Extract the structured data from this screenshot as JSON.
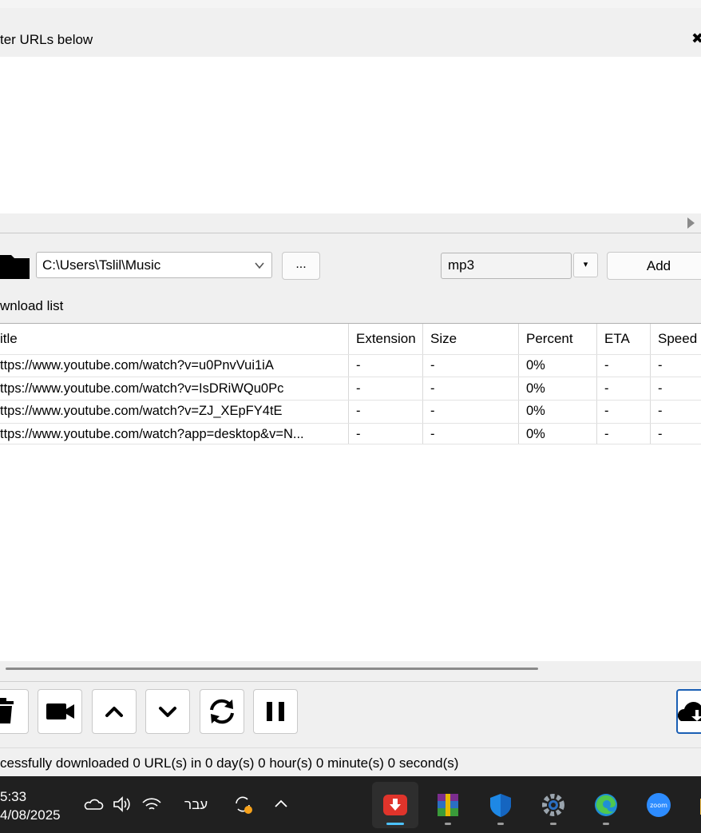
{
  "urls_panel": {
    "label": "ter URLs below",
    "close_glyph": "✖"
  },
  "toolbar": {
    "folder_icon": "folder-icon",
    "save_path": "C:\\Users\\Tslil\\Music",
    "browse_label": "...",
    "format_value": "mp3",
    "format_dropdown_glyph": "▾",
    "add_label": "Add"
  },
  "download_list": {
    "label": "wnload list",
    "columns": [
      "itle",
      "Extension",
      "Size",
      "Percent",
      "ETA",
      "Speed"
    ],
    "rows": [
      {
        "title": "ttps://www.youtube.com/watch?v=u0PnvVui1iA",
        "extension": "-",
        "size": "-",
        "percent": "0%",
        "eta": "-",
        "speed": "-"
      },
      {
        "title": "ttps://www.youtube.com/watch?v=IsDRiWQu0Pc",
        "extension": "-",
        "size": "-",
        "percent": "0%",
        "eta": "-",
        "speed": "-"
      },
      {
        "title": "ttps://www.youtube.com/watch?v=ZJ_XEpFY4tE",
        "extension": "-",
        "size": "-",
        "percent": "0%",
        "eta": "-",
        "speed": "-"
      },
      {
        "title": "ttps://www.youtube.com/watch?app=desktop&v=N...",
        "extension": "-",
        "size": "-",
        "percent": "0%",
        "eta": "-",
        "speed": "-"
      }
    ]
  },
  "actions": [
    "trash-icon",
    "video-camera-icon",
    "move-up-icon",
    "move-down-icon",
    "reload-icon",
    "pause-icon",
    "cloud-download-icon"
  ],
  "status": {
    "text": "cessfully downloaded 0 URL(s) in 0 day(s) 0 hour(s) 0 minute(s) 0 second(s)"
  },
  "taskbar": {
    "time": "5:33",
    "date": "4/08/2025",
    "language": "עבר",
    "tray_icons": [
      "onedrive-icon",
      "volume-icon",
      "wifi-icon",
      "sync-icon",
      "chevron-up-icon"
    ],
    "apps": [
      "youtube-dl-gui-icon",
      "winrar-icon",
      "windows-security-icon",
      "settings-icon",
      "edge-icon",
      "zoom-icon",
      "file-explorer-icon"
    ],
    "zoom_label": "zoom",
    "accent": "#4cc2ff"
  }
}
